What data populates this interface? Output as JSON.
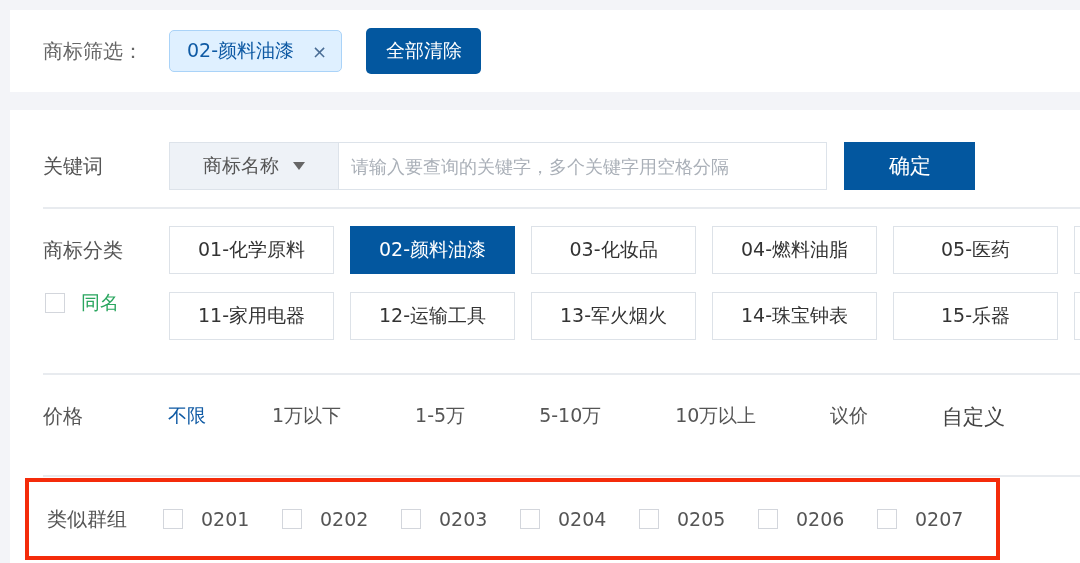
{
  "filter_bar": {
    "label": "商标筛选：",
    "tags": [
      {
        "label": "02-颜料油漆",
        "remove": "×"
      }
    ],
    "clear_button": "全部清除"
  },
  "keyword": {
    "label": "关键词",
    "field_type": "商标名称",
    "placeholder": "请输入要查询的关键字，多个关键字用空格分隔",
    "confirm_button": "确定"
  },
  "category": {
    "label": "商标分类",
    "same_name": {
      "label": "同名",
      "checked": false
    },
    "rows": [
      [
        {
          "label": "01-化学原料",
          "selected": false
        },
        {
          "label": "02-颜料油漆",
          "selected": true
        },
        {
          "label": "03-化妆品",
          "selected": false
        },
        {
          "label": "04-燃料油脂",
          "selected": false
        },
        {
          "label": "05-医药",
          "selected": false
        }
      ],
      [
        {
          "label": "11-家用电器",
          "selected": false
        },
        {
          "label": "12-运输工具",
          "selected": false
        },
        {
          "label": "13-军火烟火",
          "selected": false
        },
        {
          "label": "14-珠宝钟表",
          "selected": false
        },
        {
          "label": "15-乐器",
          "selected": false
        }
      ]
    ]
  },
  "price": {
    "label": "价格",
    "options": [
      {
        "label": "不限",
        "selected": true
      },
      {
        "label": "1万以下",
        "selected": false
      },
      {
        "label": "1-5万",
        "selected": false
      },
      {
        "label": "5-10万",
        "selected": false
      },
      {
        "label": "10万以上",
        "selected": false
      },
      {
        "label": "议价",
        "selected": false
      },
      {
        "label": "自定义",
        "selected": false
      }
    ]
  },
  "similar_group": {
    "label": "类似群组",
    "highlighted": true,
    "options": [
      {
        "label": "0201",
        "checked": false
      },
      {
        "label": "0202",
        "checked": false
      },
      {
        "label": "0203",
        "checked": false
      },
      {
        "label": "0204",
        "checked": false
      },
      {
        "label": "0205",
        "checked": false
      },
      {
        "label": "0206",
        "checked": false
      },
      {
        "label": "0207",
        "checked": false
      }
    ]
  }
}
